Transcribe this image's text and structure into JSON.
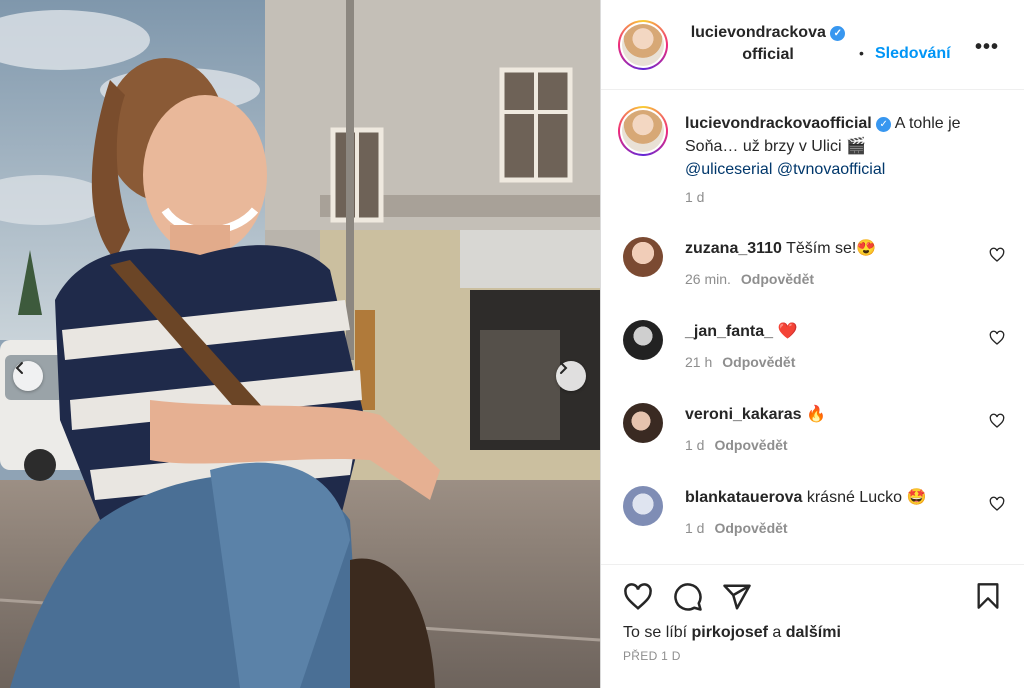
{
  "post": {
    "username": "lucievondrackovaofficial",
    "header_name_line1": "lucievondrackova",
    "header_name_line2": "official",
    "follow_label": "Sledování",
    "more_label": "•••",
    "dot": "•",
    "caption_username": "lucievondrackovaofficial",
    "caption_text": " A tohle je Soňa… už brzy v Ulici 🎬",
    "mention_1": "@uliceserial",
    "mention_2": "@tvnovaofficial",
    "caption_time": "1 d",
    "verified_glyph": "✓"
  },
  "comments": [
    {
      "username": "zuzana_3110",
      "text": " Těším se!😍",
      "time": "26 min.",
      "reply": "Odpovědět",
      "avatar_color": "#c79b86"
    },
    {
      "username": "_jan_fanta_",
      "text": " ❤️",
      "time": "21 h",
      "reply": "Odpovědět",
      "avatar_color": "#3a3a3a"
    },
    {
      "username": "veroni_kakaras",
      "text": " 🔥",
      "time": "1 d",
      "reply": "Odpovědět",
      "avatar_color": "#5a4336"
    },
    {
      "username": "blankatauerova",
      "text": " krásné Lucko 🤩",
      "time": "1 d",
      "reply": "Odpovědět",
      "avatar_color": "#9aa6c7"
    }
  ],
  "footer": {
    "likes_prefix": "To se líbí ",
    "likes_user": "pirkojosef",
    "likes_mid": " a ",
    "likes_others": "dalšími",
    "post_time": "PŘED 1 D"
  },
  "colors": {
    "accent_blue": "#0095f6",
    "verified_blue": "#3897f0",
    "muted": "#8e8e8e",
    "mention": "#00376b"
  },
  "icons": [
    "chevron-left-icon",
    "chevron-right-icon",
    "heart-icon",
    "comment-icon",
    "share-icon",
    "bookmark-icon",
    "verified-icon",
    "more-icon"
  ]
}
